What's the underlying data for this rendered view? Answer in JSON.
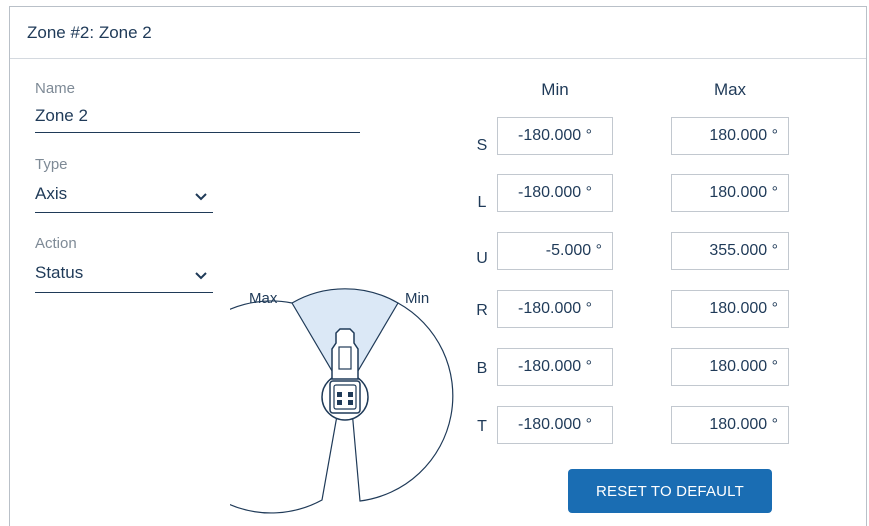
{
  "panel": {
    "title": "Zone #2: Zone 2"
  },
  "fields": {
    "name": {
      "label": "Name",
      "value": "Zone 2"
    },
    "type": {
      "label": "Type",
      "value": "Axis"
    },
    "action": {
      "label": "Action",
      "value": "Status"
    }
  },
  "limits": {
    "min_header": "Min",
    "max_header": "Max",
    "rows": [
      {
        "axis": "S",
        "min": "-180.000 °",
        "max": "180.000 °"
      },
      {
        "axis": "L",
        "min": "-180.000 °",
        "max": "180.000 °"
      },
      {
        "axis": "U",
        "min": "-5.000 °",
        "max": "355.000 °"
      },
      {
        "axis": "R",
        "min": "-180.000 °",
        "max": "180.000 °"
      },
      {
        "axis": "B",
        "min": "-180.000 °",
        "max": "180.000 °"
      },
      {
        "axis": "T",
        "min": "-180.000 °",
        "max": "180.000 °"
      }
    ]
  },
  "diagram": {
    "max_label": "Max",
    "min_label": "Min"
  },
  "buttons": {
    "reset": "RESET TO DEFAULT"
  },
  "colors": {
    "accent": "#1a6db3",
    "text": "#1f3a58",
    "zone_fill": "#dbe8f6"
  },
  "icons": {
    "dropdown": "chevron-down-icon",
    "robot": "robot-top-view-icon"
  }
}
